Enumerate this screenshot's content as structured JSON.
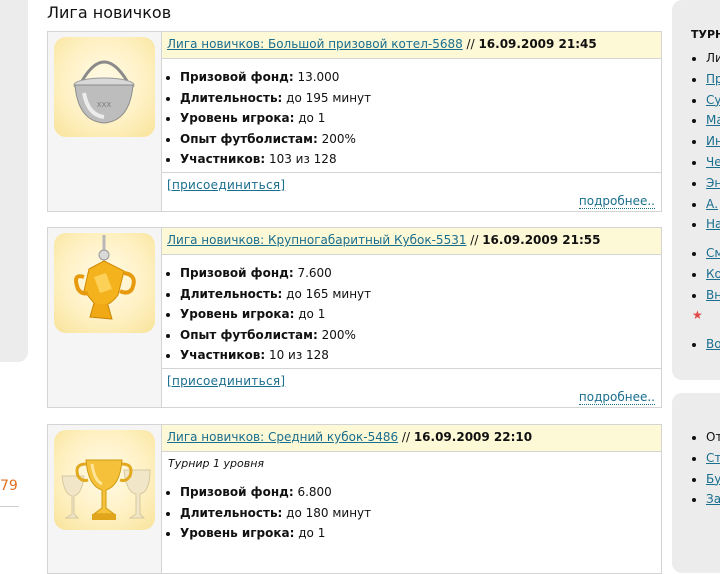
{
  "left": {
    "number": "79"
  },
  "section_title": "Лига новичков",
  "tournaments": [
    {
      "title": "Лига новичков: Большой призовой котел-5688",
      "separator": " // ",
      "date": "16.09.2009 21:45",
      "details": [
        {
          "label": "Призовой фонд:",
          "value": " 13.000"
        },
        {
          "label": "Длительность:",
          "value": " до 195 минут"
        },
        {
          "label": "Уровень игрока:",
          "value": " до 1"
        },
        {
          "label": "Опыт футболистам:",
          "value": " 200%"
        },
        {
          "label": "Участников:",
          "value": " 103 из 128"
        }
      ],
      "join_label": "[присоединиться]",
      "more_label": "подробнее.."
    },
    {
      "title": "Лига новичков: Крупногабаритный Кубок-5531",
      "separator": " // ",
      "date": "16.09.2009 21:55",
      "details": [
        {
          "label": "Призовой фонд:",
          "value": " 7.600"
        },
        {
          "label": "Длительность:",
          "value": " до 165 минут"
        },
        {
          "label": "Уровень игрока:",
          "value": " до 1"
        },
        {
          "label": "Опыт футболистам:",
          "value": " 200%"
        },
        {
          "label": "Участников:",
          "value": " 10 из 128"
        }
      ],
      "join_label": "[присоединиться]",
      "more_label": "подробнее.."
    },
    {
      "title": "Лига новичков: Средний кубок-5486",
      "separator": " // ",
      "date": "16.09.2009 22:10",
      "level_note": "Турнир 1 уровня",
      "details": [
        {
          "label": "Призовой фонд:",
          "value": " 6.800"
        },
        {
          "label": "Длительность:",
          "value": " до 180 минут"
        },
        {
          "label": "Уровень игрока:",
          "value": " до 1"
        }
      ]
    }
  ],
  "sidebar": {
    "box1_title": "ТУРН",
    "box1_items": [
      "Ли",
      "Пр",
      "Су",
      "Ма",
      "Ин",
      "Че",
      "Эн",
      "А.",
      "На"
    ],
    "box1_items2": [
      "См",
      "Ко",
      "Вн",
      ""
    ],
    "box1_items3": [
      "Во"
    ],
    "box2_items": [
      "От",
      "Ст",
      "Бу",
      "За"
    ]
  },
  "colors": {
    "link": "#1a6e8e",
    "header_bg": "#fdf8d6",
    "accent_number": "#e07020"
  }
}
